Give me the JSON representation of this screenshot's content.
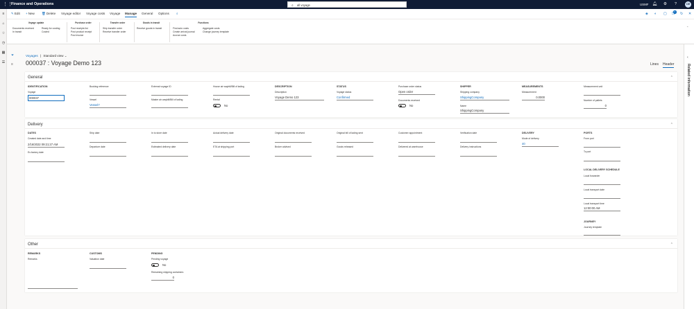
{
  "app": {
    "name": "Finance and Operations",
    "search_value": "all voyage",
    "company": "USMF",
    "avatar_initials": "CE"
  },
  "actionbar": {
    "edit": "Edit",
    "new": "New",
    "delete": "Delete",
    "voyage_editor": "Voyage editor",
    "voyage_costs": "Voyage costs",
    "tabs": [
      "Voyage",
      "Manage",
      "General",
      "Options"
    ],
    "active_tab": "Manage",
    "notification_count": "3"
  },
  "ribbon": {
    "voyage_update": {
      "title": "Voyage update",
      "items": [
        "Documents received",
        "In transit",
        "Ready for costing",
        "Costed"
      ]
    },
    "purchase_order": {
      "title": "Purchase order",
      "items": [
        "Post receipts list",
        "Post product receipt",
        "Post invoice"
      ]
    },
    "transfer_order": {
      "title": "Transfer order",
      "items": [
        "Ship transfer order",
        "Receive transfer order"
      ]
    },
    "goods_in_transit": {
      "title": "Goods in transit",
      "items": [
        "Receive goods in transit"
      ]
    },
    "functions": {
      "title": "Functions",
      "items": [
        "Find auto costs",
        "Create arrival journal",
        "Accrue costs",
        "Aggregate costs",
        "Change journey template"
      ]
    }
  },
  "breadcrumb": {
    "link": "Voyages",
    "separator": "|",
    "view": "Standard view"
  },
  "page_title": "000037 : Voyage Demo 123",
  "view_tabs": {
    "lines": "Lines",
    "header": "Header"
  },
  "right_pane": {
    "label": "Related information"
  },
  "general": {
    "title": "General",
    "identification": {
      "header": "IDENTIFICATION",
      "voyage_label": "Voyage",
      "voyage_value": "000037"
    },
    "booking_reference": {
      "label": "Booking reference",
      "value": ""
    },
    "vessel": {
      "label": "Vessel",
      "value": "Vessel7"
    },
    "external_voyage_id": {
      "label": "External voyage ID",
      "value": ""
    },
    "master_waybill": {
      "label": "Master air waybill/Bill of lading",
      "value": ""
    },
    "house_waybill": {
      "label": "House air waybill/Bill of lading",
      "value": ""
    },
    "rental": {
      "label": "Rental",
      "value": "No"
    },
    "description": {
      "header": "DESCRIPTION",
      "label": "Description",
      "value": "Voyage Demo 123"
    },
    "status": {
      "header": "STATUS",
      "label": "Voyage status",
      "value": "Confirmed"
    },
    "po_status": {
      "label": "Purchase order status",
      "value": "Open order"
    },
    "docs_received": {
      "label": "Documents received",
      "value": "No"
    },
    "shipper": {
      "header": "SHIPPER",
      "company_label": "Shipping company",
      "company_value": "ShippingCompany",
      "name_label": "Name",
      "name_value": "ShippingCompany"
    },
    "measurements": {
      "header": "MEASUREMENTS",
      "label": "Measurement",
      "value": "0.0000"
    },
    "measurement_unit": {
      "label": "Measurement unit",
      "value": ""
    },
    "pallets": {
      "label": "Number of pallets",
      "value": "0"
    }
  },
  "delivery": {
    "title": "Delivery",
    "dates": {
      "header": "DATES",
      "created_label": "Created date and time",
      "created_value": "2/16/2022 09:21:27 AM",
      "ex_factory_label": "Ex-factory date"
    },
    "ship_date": "Ship date",
    "departure_date": "Departure date",
    "in_store_date": "In to store date",
    "est_delivery_date": "Estimated delivery date",
    "actual_delivery_date": "Actual delivery date",
    "eta_port": "ETA at shipping port",
    "orig_docs_received": "Original documents received",
    "broker_advised": "Broker advised",
    "orig_bol_sent": "Original bill of lading sent",
    "goods_released": "Goods released",
    "customer_appointment": "Customer appointment",
    "delivered_warehouse": "Delivered at warehouse",
    "verification_date": "Verification date",
    "delivery_instructions": "Delivery instructions",
    "delivery_group": {
      "header": "DELIVERY",
      "mode_label": "Mode of delivery",
      "mode_value": "40"
    },
    "ports": {
      "header": "PORTS",
      "from": "From port",
      "to": "To port"
    },
    "local_schedule": {
      "header": "LOCAL DELIVERY SCHEDULE",
      "forwarder": "Local forwarder",
      "transport_date": "Local transport date",
      "transport_time_label": "Local transport time",
      "transport_time_value": "12:00:00 AM"
    },
    "journey": {
      "header": "JOURNEY",
      "template": "Journey template"
    }
  },
  "other": {
    "title": "Other",
    "remarks": {
      "header": "REMARKS",
      "label": "Remarks"
    },
    "customs": {
      "header": "CUSTOMS",
      "label": "Valuation date"
    },
    "pending": {
      "header": "PENDING",
      "voyage_label": "Pending voyage",
      "voyage_value": "No",
      "containers_label": "Remaining shipping containers",
      "containers_value": "0"
    }
  }
}
